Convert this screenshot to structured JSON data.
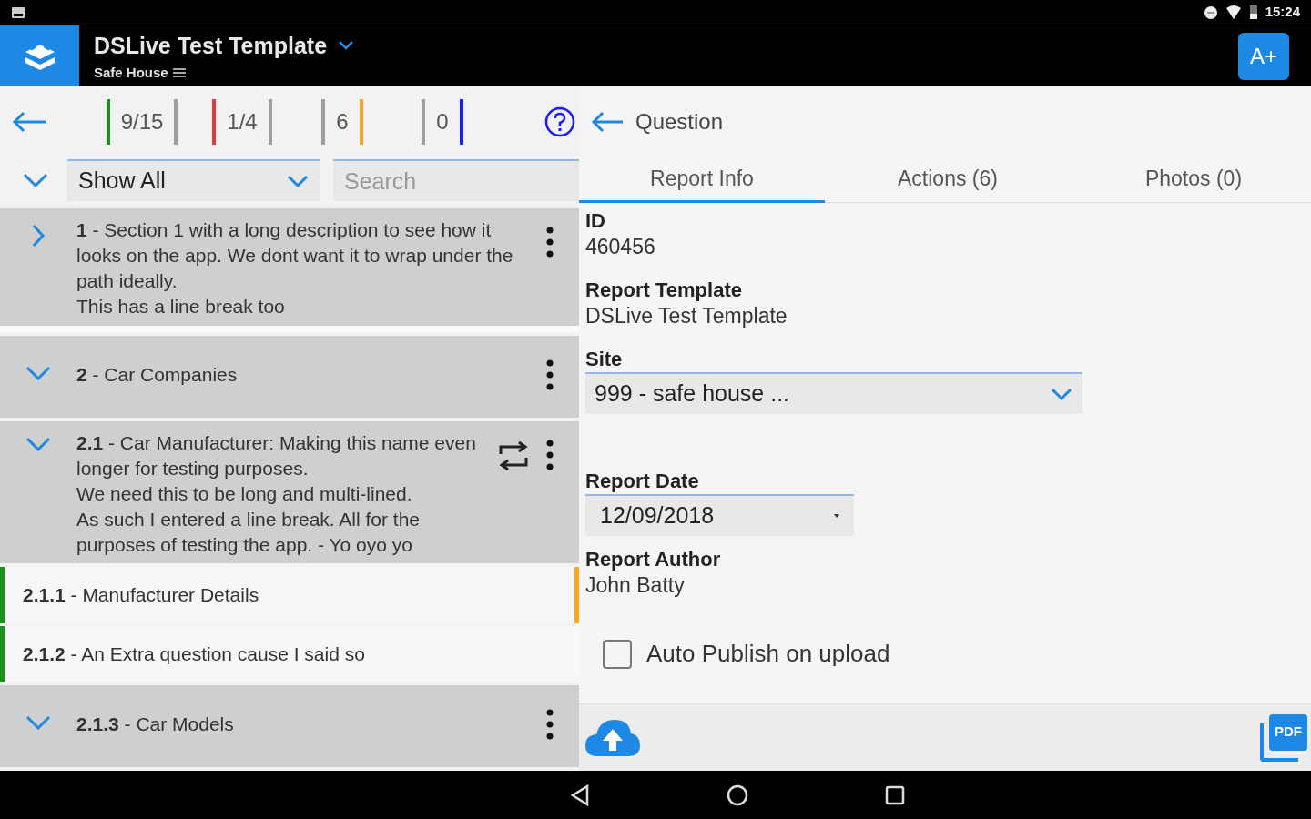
{
  "status_bar": {
    "time": "15:24"
  },
  "app_bar": {
    "title": "DSLive Test Template",
    "subtitle": "Safe House",
    "action": "A+"
  },
  "counters": [
    {
      "kind": "ratio",
      "value": "9/15",
      "color": "#1e8e1e"
    },
    {
      "kind": "ratio",
      "value": "1/4",
      "color": "#e53935"
    },
    {
      "kind": "count",
      "value": "6",
      "color": "#f5a623"
    },
    {
      "kind": "count",
      "value": "0",
      "color": "#1a1aff"
    }
  ],
  "filter": {
    "value": "Show All"
  },
  "search": {
    "placeholder": "Search"
  },
  "outline": [
    {
      "kind": "section",
      "title": "**1** - Section 1 with a long description to see how it looks on the app. We dont want it to wrap under the path ideally.\nThis has a line break too",
      "expanded": false,
      "repeat": false
    },
    {
      "kind": "section",
      "title": "**2** - Car Companies",
      "expanded": true,
      "repeat": false,
      "children": [
        {
          "kind": "section",
          "title": "**2.1** - Car Manufacturer: Making this name even longer for testing purposes.\nWe need this to be long and multi-lined.\nAs such I entered a line break. All for the purposes of testing the app. - Yo oyo yo",
          "expanded": true,
          "repeat": true,
          "children": [
            {
              "kind": "question",
              "title": "**2.1.1** - Manufacturer Details",
              "color": "#1e8e1e",
              "flagged": true
            },
            {
              "kind": "question",
              "title": "**2.1.2** - An Extra question cause I said so",
              "color": "#1e8e1e",
              "flagged": false
            },
            {
              "kind": "section",
              "title": "**2.1.3** - Car Models",
              "expanded": true,
              "repeat": false
            }
          ]
        }
      ]
    }
  ],
  "question_header": {
    "label": "Question"
  },
  "tabs": [
    {
      "label": "Report Info",
      "selected": true
    },
    {
      "label": "Actions (6)",
      "selected": false
    },
    {
      "label": "Photos (0)",
      "selected": false
    }
  ],
  "fields": [
    {
      "kind": "text",
      "label": "ID",
      "value": "460456"
    },
    {
      "kind": "text",
      "label": "Report Template",
      "value": "DSLive Test Template"
    },
    {
      "kind": "select",
      "label": "Site",
      "value": "999 - safe house ..."
    },
    {
      "kind": "date",
      "label": "Report Date",
      "value": "12/09/2018"
    },
    {
      "kind": "text",
      "label": "Report Author",
      "value": "John Batty"
    }
  ],
  "auto_publish": {
    "label": "Auto Publish on upload",
    "checked": false
  },
  "pdf_button": {
    "label": "PDF"
  }
}
